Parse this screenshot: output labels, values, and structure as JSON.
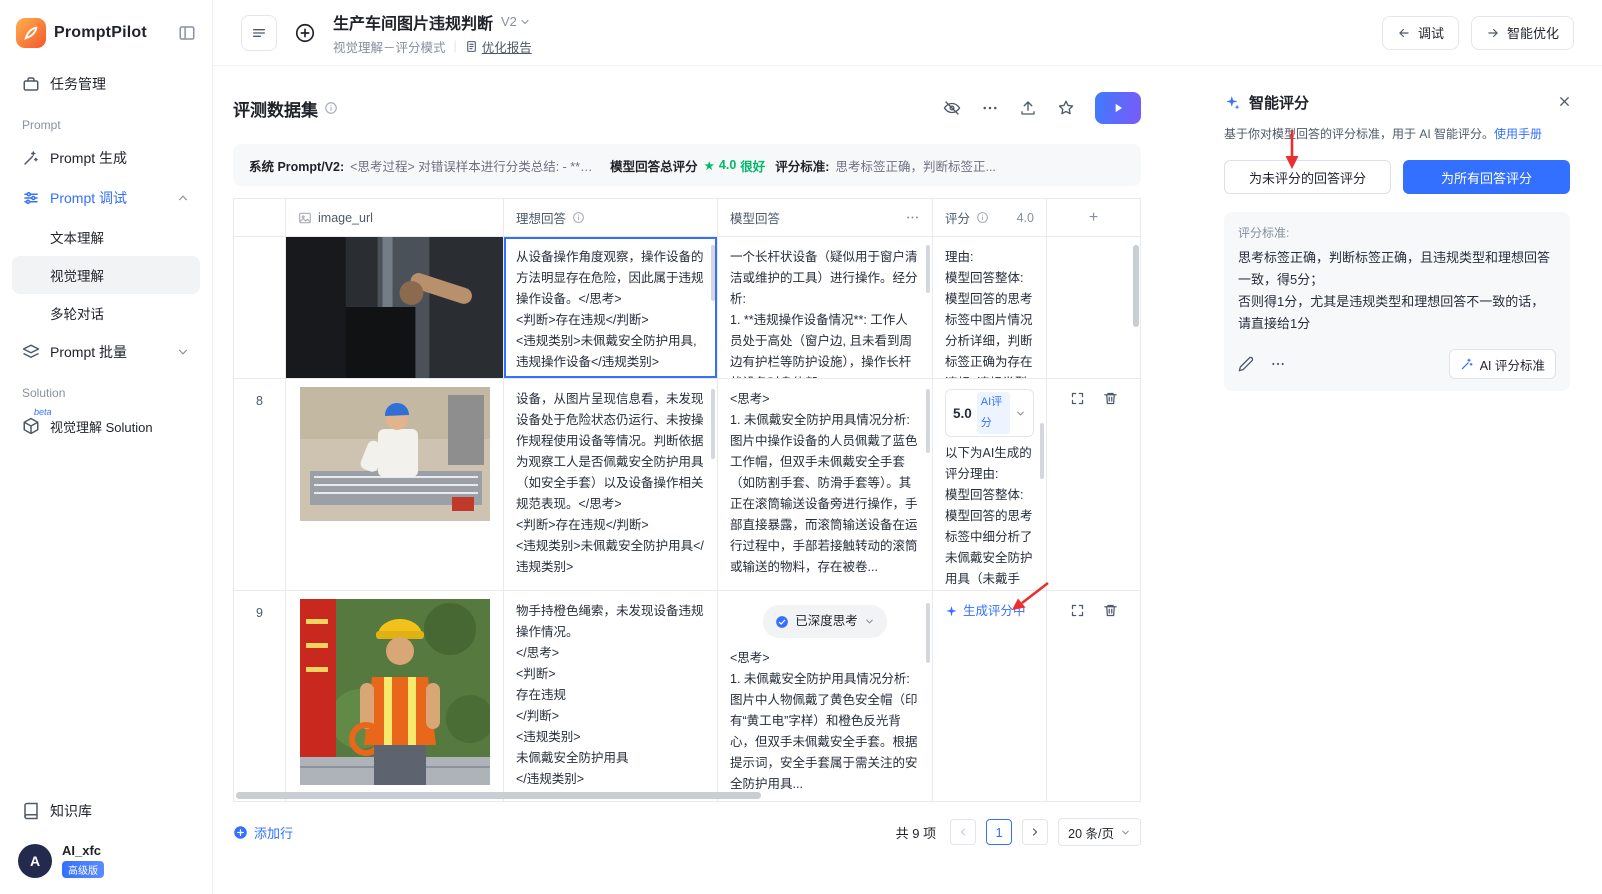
{
  "colors": {
    "accent": "#3370ff",
    "success": "#00b96b",
    "annotation": "#eb2f2f",
    "play_gradient": [
      "#3f7bff",
      "#7a5af8"
    ]
  },
  "icons": {
    "play": "▶",
    "close": "✕",
    "more": "⋯",
    "sparkle": "✦",
    "star": "☆",
    "rating_star": "★",
    "add": "+"
  },
  "brand": {
    "name": "PromptPilot"
  },
  "sidebar": {
    "task_mgmt": "任务管理",
    "section_prompt": "Prompt",
    "prompt_gen": "Prompt 生成",
    "prompt_debug": "Prompt 调试",
    "debug_items": {
      "text": "文本理解",
      "vision": "视觉理解",
      "multi": "多轮对话"
    },
    "prompt_batch": "Prompt 批量",
    "section_solution": "Solution",
    "solution_item": "视觉理解 Solution",
    "solution_beta": "beta",
    "knowledge": "知识库",
    "user_avatar": "A",
    "user_name": "AI_xfc",
    "user_badge": "高级版"
  },
  "topbar": {
    "title": "生产车间图片违规判断",
    "version": "V2",
    "mode": "视觉理解－评分模式",
    "report": "优化报告",
    "debug": "调试",
    "optimize": "智能优化"
  },
  "dataset": {
    "title": "评测数据集",
    "info": {
      "sys_label": "系统 Prompt/V2:",
      "sys_text": "<思考过程> 对错误样本进行分类总结: - **违规操作设...",
      "score_label": "模型回答总评分",
      "score_value": "4.0",
      "score_desc": "很好",
      "criteria_label": "评分标准:",
      "criteria_text": "思考标签正确，判断标签正..."
    },
    "columns": {
      "image": "image_url",
      "ideal": "理想回答",
      "model": "模型回答",
      "score": "评分",
      "score_avg": "4.0",
      "add": "+"
    },
    "rows": [
      {
        "num": "",
        "ideal": "从设备操作角度观察，操作设备的方法明显存在危险，因此属于违规操作设备。</思考>\n<判断>存在违规</判断>\n<违规类别>未佩戴安全防护用具, 违规操作设备</违规类别>",
        "model": "一个长杆状设备（疑似用于窗户清洁或维护的工具）进行操作。经分析:\n1. **违规操作设备情况**: 工作人员处于高处（窗户边, 且未看到周边有护栏等防护设施），操作长杆状设备时身体部...",
        "score_text": "理由:\n模型回答整体: 模型回答的思考标签中图片情况分析详细，判断标签正确为存在违规, 违规类型与理想回答一..."
      },
      {
        "num": "8",
        "ideal": "设备，从图片呈现信息看，未发现设备处于危险状态仍运行、未按操作规程使用设备等情况。判断依据为观察工人是否佩戴安全防护用具（如安全手套）以及设备操作相关规范表现。</思考>\n<判断>存在违规</判断>\n<违规类别>未佩戴安全防护用具</违规类别>",
        "model": "<思考>\n1. 未佩戴安全防护用具情况分析: 图片中操作设备的人员佩戴了蓝色工作帽，但双手未佩戴安全手套（如防割手套、防滑手套等）。其正在滚筒输送设备旁进行操作，手部直接暴露，而滚筒输送设备在运行过程中，手部若接触转动的滚筒或输送的物料，存在被卷...",
        "score": "5.0",
        "score_badge": "AI评分",
        "score_text": "以下为AI生成的评分理由:\n模型回答整体: 模型回答的思考标签中细分析了未佩戴安全防护用具（未戴手套）的情况及风险..."
      },
      {
        "num": "9",
        "ideal": "物手持橙色绳索，未发现设备违规操作情况。\n</思考>\n<判断>\n存在违规\n</判断>\n<违规类别>\n未佩戴安全防护用具\n</违规类别>",
        "model_badge": "已深度思考",
        "model": "<思考>\n1. 未佩戴安全防护用具情况分析: 图片中人物佩戴了黄色安全帽（印有“黄工电”字样）和橙色反光背心，但双手未佩戴安全手套。根据提示词，安全手套属于需关注的安全防护用具...",
        "score_status": "生成评分中"
      }
    ],
    "footer": {
      "add_row": "添加行",
      "total": "共 9 项",
      "page": "1",
      "page_size": "20 条/页"
    }
  },
  "panel": {
    "title": "智能评分",
    "desc": "基于你对模型回答的评分标准，用于 AI 智能评分。",
    "manual": "使用手册",
    "btn_unscored": "为未评分的回答评分",
    "btn_all": "为所有回答评分",
    "criteria_label": "评分标准:",
    "criteria_line1": "思考标签正确，判断标签正确，且违规类型和理想回答一致，得5分；",
    "criteria_line2": "否则得1分，尤其是违规类型和理想回答不一致的话，请直接给1分",
    "ai_btn": "AI 评分标准"
  }
}
